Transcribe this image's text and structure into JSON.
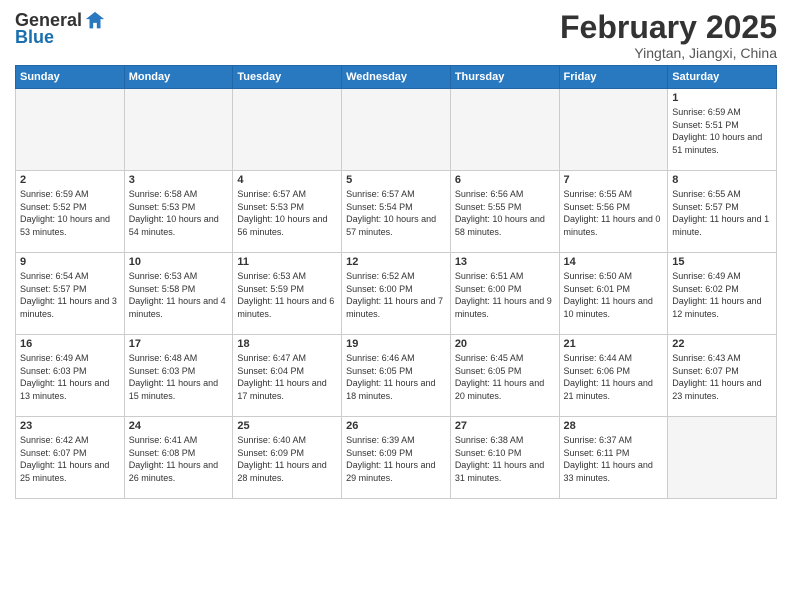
{
  "header": {
    "logo_general": "General",
    "logo_blue": "Blue",
    "title": "February 2025",
    "subtitle": "Yingtan, Jiangxi, China"
  },
  "weekdays": [
    "Sunday",
    "Monday",
    "Tuesday",
    "Wednesday",
    "Thursday",
    "Friday",
    "Saturday"
  ],
  "weeks": [
    [
      {
        "day": "",
        "empty": true
      },
      {
        "day": "",
        "empty": true
      },
      {
        "day": "",
        "empty": true
      },
      {
        "day": "",
        "empty": true
      },
      {
        "day": "",
        "empty": true
      },
      {
        "day": "",
        "empty": true
      },
      {
        "day": "1",
        "sunrise": "6:59 AM",
        "sunset": "5:51 PM",
        "daylight": "10 hours and 51 minutes."
      }
    ],
    [
      {
        "day": "2",
        "sunrise": "6:59 AM",
        "sunset": "5:52 PM",
        "daylight": "10 hours and 53 minutes."
      },
      {
        "day": "3",
        "sunrise": "6:58 AM",
        "sunset": "5:53 PM",
        "daylight": "10 hours and 54 minutes."
      },
      {
        "day": "4",
        "sunrise": "6:57 AM",
        "sunset": "5:53 PM",
        "daylight": "10 hours and 56 minutes."
      },
      {
        "day": "5",
        "sunrise": "6:57 AM",
        "sunset": "5:54 PM",
        "daylight": "10 hours and 57 minutes."
      },
      {
        "day": "6",
        "sunrise": "6:56 AM",
        "sunset": "5:55 PM",
        "daylight": "10 hours and 58 minutes."
      },
      {
        "day": "7",
        "sunrise": "6:55 AM",
        "sunset": "5:56 PM",
        "daylight": "11 hours and 0 minutes."
      },
      {
        "day": "8",
        "sunrise": "6:55 AM",
        "sunset": "5:57 PM",
        "daylight": "11 hours and 1 minute."
      }
    ],
    [
      {
        "day": "9",
        "sunrise": "6:54 AM",
        "sunset": "5:57 PM",
        "daylight": "11 hours and 3 minutes."
      },
      {
        "day": "10",
        "sunrise": "6:53 AM",
        "sunset": "5:58 PM",
        "daylight": "11 hours and 4 minutes."
      },
      {
        "day": "11",
        "sunrise": "6:53 AM",
        "sunset": "5:59 PM",
        "daylight": "11 hours and 6 minutes."
      },
      {
        "day": "12",
        "sunrise": "6:52 AM",
        "sunset": "6:00 PM",
        "daylight": "11 hours and 7 minutes."
      },
      {
        "day": "13",
        "sunrise": "6:51 AM",
        "sunset": "6:00 PM",
        "daylight": "11 hours and 9 minutes."
      },
      {
        "day": "14",
        "sunrise": "6:50 AM",
        "sunset": "6:01 PM",
        "daylight": "11 hours and 10 minutes."
      },
      {
        "day": "15",
        "sunrise": "6:49 AM",
        "sunset": "6:02 PM",
        "daylight": "11 hours and 12 minutes."
      }
    ],
    [
      {
        "day": "16",
        "sunrise": "6:49 AM",
        "sunset": "6:03 PM",
        "daylight": "11 hours and 13 minutes."
      },
      {
        "day": "17",
        "sunrise": "6:48 AM",
        "sunset": "6:03 PM",
        "daylight": "11 hours and 15 minutes."
      },
      {
        "day": "18",
        "sunrise": "6:47 AM",
        "sunset": "6:04 PM",
        "daylight": "11 hours and 17 minutes."
      },
      {
        "day": "19",
        "sunrise": "6:46 AM",
        "sunset": "6:05 PM",
        "daylight": "11 hours and 18 minutes."
      },
      {
        "day": "20",
        "sunrise": "6:45 AM",
        "sunset": "6:05 PM",
        "daylight": "11 hours and 20 minutes."
      },
      {
        "day": "21",
        "sunrise": "6:44 AM",
        "sunset": "6:06 PM",
        "daylight": "11 hours and 21 minutes."
      },
      {
        "day": "22",
        "sunrise": "6:43 AM",
        "sunset": "6:07 PM",
        "daylight": "11 hours and 23 minutes."
      }
    ],
    [
      {
        "day": "23",
        "sunrise": "6:42 AM",
        "sunset": "6:07 PM",
        "daylight": "11 hours and 25 minutes."
      },
      {
        "day": "24",
        "sunrise": "6:41 AM",
        "sunset": "6:08 PM",
        "daylight": "11 hours and 26 minutes."
      },
      {
        "day": "25",
        "sunrise": "6:40 AM",
        "sunset": "6:09 PM",
        "daylight": "11 hours and 28 minutes."
      },
      {
        "day": "26",
        "sunrise": "6:39 AM",
        "sunset": "6:09 PM",
        "daylight": "11 hours and 29 minutes."
      },
      {
        "day": "27",
        "sunrise": "6:38 AM",
        "sunset": "6:10 PM",
        "daylight": "11 hours and 31 minutes."
      },
      {
        "day": "28",
        "sunrise": "6:37 AM",
        "sunset": "6:11 PM",
        "daylight": "11 hours and 33 minutes."
      },
      {
        "day": "",
        "empty": true
      }
    ]
  ]
}
